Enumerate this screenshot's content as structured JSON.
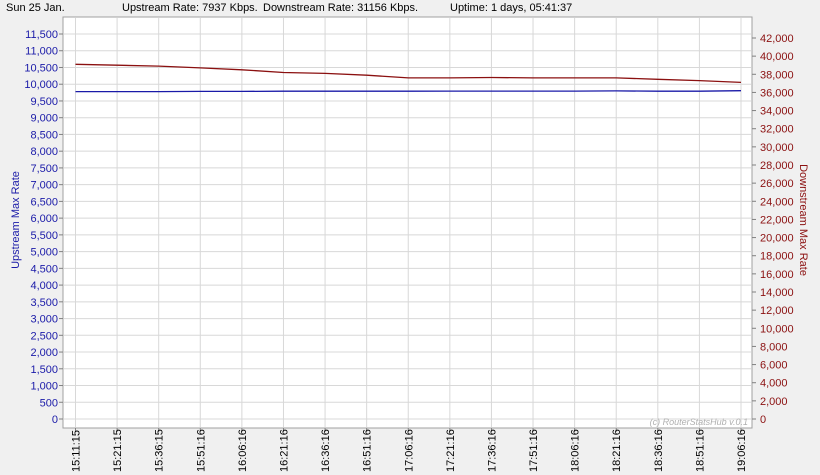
{
  "status": {
    "date": "Sun 25 Jan.",
    "upstream": "Upstream Rate: 7937 Kbps.",
    "downstream": "Downstream Rate: 31156 Kbps.",
    "uptime": "Uptime: 1 days, 05:41:37"
  },
  "watermark": "(c) RouterStatsHub v.0.1",
  "colors": {
    "upstream": "#1a1aa8",
    "downstream": "#8b1010",
    "grid": "#d8d8d8"
  },
  "chart_data": {
    "type": "line",
    "x_ticks": [
      "15:11:15",
      "15:21:15",
      "15:36:15",
      "15:51:16",
      "16:06:16",
      "16:21:16",
      "16:36:16",
      "16:51:16",
      "17:06:16",
      "17:21:16",
      "17:36:16",
      "17:51:16",
      "18:06:16",
      "18:21:16",
      "18:36:16",
      "18:51:16",
      "19:06:16"
    ],
    "left_axis": {
      "label": "Upstream Max Rate",
      "ylim": [
        0,
        11500
      ],
      "ticks": [
        0,
        500,
        1000,
        1500,
        2000,
        2500,
        3000,
        3500,
        4000,
        4500,
        5000,
        5500,
        6000,
        6500,
        7000,
        7500,
        8000,
        8500,
        9000,
        9500,
        10000,
        10500,
        11000,
        11500
      ],
      "tick_labels": [
        "0",
        "500",
        "1,000",
        "1,500",
        "2,000",
        "2,500",
        "3,000",
        "3,500",
        "4,000",
        "4,500",
        "5,000",
        "5,500",
        "6,000",
        "6,500",
        "7,000",
        "7,500",
        "8,000",
        "8,500",
        "9,000",
        "9,500",
        "10,000",
        "10,500",
        "11,000",
        "11,500"
      ]
    },
    "right_axis": {
      "label": "Downstream Max Rate",
      "ylim": [
        0,
        42000
      ],
      "ticks": [
        0,
        2000,
        4000,
        6000,
        8000,
        10000,
        12000,
        14000,
        16000,
        18000,
        20000,
        22000,
        24000,
        26000,
        28000,
        30000,
        32000,
        34000,
        36000,
        38000,
        40000,
        42000
      ],
      "tick_labels": [
        "0",
        "2,000",
        "4,000",
        "6,000",
        "8,000",
        "10,000",
        "12,000",
        "14,000",
        "16,000",
        "18,000",
        "20,000",
        "22,000",
        "24,000",
        "26,000",
        "28,000",
        "30,000",
        "32,000",
        "34,000",
        "36,000",
        "38,000",
        "40,000",
        "42,000"
      ]
    },
    "series": [
      {
        "name": "Upstream Max Rate",
        "axis": "left",
        "x": [
          "15:11:15",
          "15:21:15",
          "15:36:15",
          "15:51:16",
          "16:06:16",
          "16:21:16",
          "16:36:16",
          "16:51:16",
          "17:06:16",
          "17:21:16",
          "17:36:16",
          "17:51:16",
          "18:06:16",
          "18:21:16",
          "18:36:16",
          "18:51:16",
          "19:06:16"
        ],
        "values": [
          9780,
          9780,
          9780,
          9785,
          9785,
          9790,
          9790,
          9790,
          9790,
          9795,
          9795,
          9795,
          9795,
          9800,
          9790,
          9790,
          9805
        ]
      },
      {
        "name": "Downstream Max Rate",
        "axis": "right",
        "x": [
          "15:11:15",
          "15:21:15",
          "15:36:15",
          "15:51:16",
          "16:06:16",
          "16:21:16",
          "16:36:16",
          "16:51:16",
          "17:06:16",
          "17:21:16",
          "17:36:16",
          "17:51:16",
          "18:06:16",
          "18:21:16",
          "18:36:16",
          "18:51:16",
          "19:06:16"
        ],
        "values": [
          39100,
          39000,
          38900,
          38700,
          38500,
          38200,
          38100,
          37900,
          37600,
          37600,
          37650,
          37600,
          37600,
          37600,
          37450,
          37300,
          37100
        ]
      }
    ],
    "grid": true
  }
}
